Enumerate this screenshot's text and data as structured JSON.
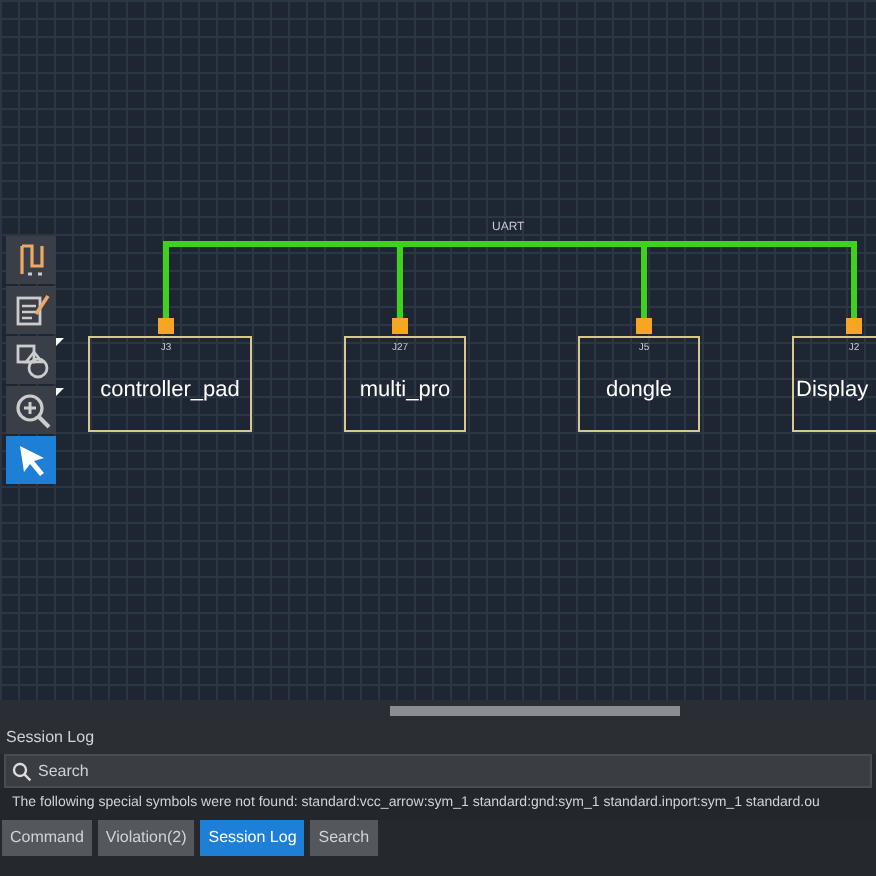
{
  "toolbar": {
    "tools": [
      {
        "kind": "wire",
        "selected": false,
        "flyout": false
      },
      {
        "kind": "edit",
        "selected": false,
        "flyout": false
      },
      {
        "kind": "shapes",
        "selected": false,
        "flyout": true
      },
      {
        "kind": "zoom",
        "selected": false,
        "flyout": true
      },
      {
        "kind": "pointer",
        "selected": true,
        "flyout": false
      }
    ]
  },
  "canvas": {
    "bus_label": "UART",
    "blocks": [
      {
        "name": "controller_pad",
        "pin_label": "J3"
      },
      {
        "name": "multi_pro",
        "pin_label": "J27"
      },
      {
        "name": "dongle",
        "pin_label": "J5"
      },
      {
        "name": "Display",
        "pin_label": "J2"
      }
    ]
  },
  "panel": {
    "title": "Session Log",
    "search": {
      "placeholder": "Search"
    },
    "log_lines": [
      "The following special symbols were not found: standard:vcc_arrow:sym_1 standard:gnd:sym_1 standard.inport:sym_1 standard.ou"
    ]
  },
  "tabs": [
    {
      "label": "Command",
      "selected": false
    },
    {
      "label": "Violation(2)",
      "selected": false
    },
    {
      "label": "Session Log",
      "selected": true
    },
    {
      "label": "Search",
      "selected": false
    }
  ]
}
